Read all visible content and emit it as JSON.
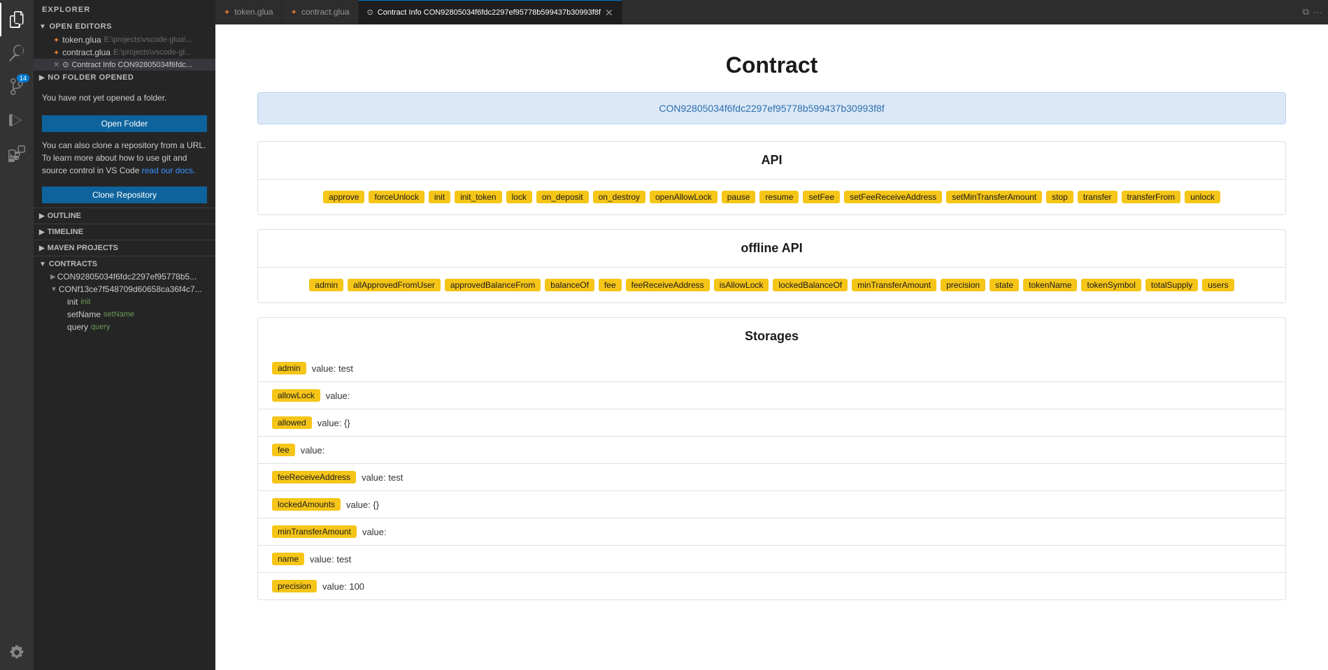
{
  "app": {
    "title": "EXPLORER"
  },
  "activity_bar": {
    "icons": [
      {
        "name": "files-icon",
        "symbol": "⧉",
        "active": true
      },
      {
        "name": "search-icon",
        "symbol": "🔍"
      },
      {
        "name": "source-control-icon",
        "symbol": "⎇",
        "badge": "14"
      },
      {
        "name": "run-icon",
        "symbol": "▷"
      },
      {
        "name": "extensions-icon",
        "symbol": "⊞"
      },
      {
        "name": "remote-icon",
        "symbol": "⚡"
      }
    ]
  },
  "sidebar": {
    "header": "EXPLORER",
    "open_editors": {
      "label": "OPEN EDITORS",
      "files": [
        {
          "name": "token.glua",
          "path": "E:\\projects\\vscode-glua\\...",
          "icon": "lua",
          "closable": false
        },
        {
          "name": "contract.glua",
          "path": "E:\\projects\\vscode-gl...",
          "icon": "lua",
          "closable": false
        },
        {
          "name": "Contract Info CON92805034f6fdc...",
          "path": "",
          "icon": "info",
          "closable": true
        }
      ]
    },
    "no_folder": {
      "label": "NO FOLDER OPENED",
      "message": "You have not yet opened a folder.",
      "open_btn": "Open Folder",
      "clone_text1": "You can also clone a repository from a URL. To learn more about how to use git and source control in VS Code",
      "clone_link": "read our docs.",
      "clone_btn": "Clone Repository"
    },
    "outline": {
      "label": "OUTLINE"
    },
    "timeline": {
      "label": "TIMELINE"
    },
    "maven_projects": {
      "label": "MAVEN PROJECTS"
    },
    "contracts": {
      "label": "CONTRACTS",
      "items": [
        {
          "id": "CON92805034f6fdc2297ef95778b5...",
          "expanded": false
        },
        {
          "id": "CONf13ce7f548709d60658ca36f4c7...",
          "expanded": true,
          "children": [
            {
              "name": "init",
              "sublabel": "init"
            },
            {
              "name": "setName",
              "sublabel": "setName"
            },
            {
              "name": "query",
              "sublabel": "query"
            }
          ]
        }
      ]
    }
  },
  "tabs": [
    {
      "label": "token.glua",
      "icon": "lua",
      "active": false,
      "closable": false
    },
    {
      "label": "contract.glua",
      "icon": "lua",
      "active": false,
      "closable": false
    },
    {
      "label": "Contract Info CON92805034f6fdc2297ef95778b599437b30993f8f",
      "icon": "info",
      "active": true,
      "closable": true
    }
  ],
  "main": {
    "contract_title": "Contract",
    "contract_id": "CON92805034f6fdc2297ef95778b599437b30993f8f",
    "api": {
      "title": "API",
      "tags": [
        "approve",
        "forceUnlock",
        "init",
        "init_token",
        "lock",
        "on_deposit",
        "on_destroy",
        "openAllowLock",
        "pause",
        "resume",
        "setFee",
        "setFeeReceiveAddress",
        "setMinTransferAmount",
        "stop",
        "transfer",
        "transferFrom",
        "unlock"
      ]
    },
    "offline_api": {
      "title": "offline API",
      "tags": [
        "admin",
        "allApprovedFromUser",
        "approvedBalanceFrom",
        "balanceOf",
        "fee",
        "feeReceiveAddress",
        "isAllowLock",
        "lockedBalanceOf",
        "minTransferAmount",
        "precision",
        "state",
        "tokenName",
        "tokenSymbol",
        "totalSupply",
        "users"
      ]
    },
    "storages": {
      "title": "Storages",
      "rows": [
        {
          "key": "admin",
          "value": "value: test"
        },
        {
          "key": "allowLock",
          "value": "value:"
        },
        {
          "key": "allowed",
          "value": "value: {}"
        },
        {
          "key": "fee",
          "value": "value:"
        },
        {
          "key": "feeReceiveAddress",
          "value": "value: test"
        },
        {
          "key": "lockedAmounts",
          "value": "value: {}"
        },
        {
          "key": "minTransferAmount",
          "value": "value:"
        },
        {
          "key": "name",
          "value": "value: test"
        },
        {
          "key": "precision",
          "value": "value: 100"
        }
      ]
    }
  }
}
